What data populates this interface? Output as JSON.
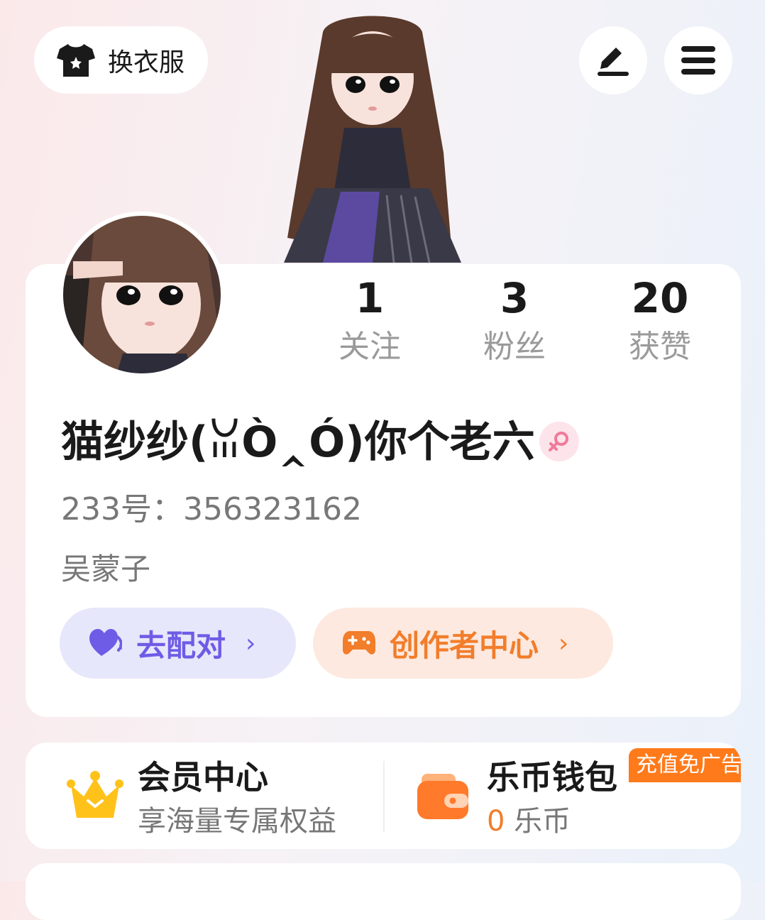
{
  "header": {
    "outfit_label": "换衣服",
    "icons": [
      "tshirt-icon",
      "pen-icon",
      "menu-icon"
    ]
  },
  "stats": [
    {
      "value": "1",
      "label": "关注"
    },
    {
      "value": "3",
      "label": "粉丝"
    },
    {
      "value": "20",
      "label": "获赞"
    }
  ],
  "profile": {
    "nickname": "猫纱纱(ꈍÒ‸Ó)你个老六",
    "gender_icon": "female-icon",
    "uid_label": "233号：",
    "uid_value": "356323162",
    "signature": "吴蒙子"
  },
  "actions": {
    "match_label": "去配对",
    "creator_label": "创作者中心",
    "chevron": "›"
  },
  "services": {
    "vip_title": "会员中心",
    "vip_sub": "享海量专属权益",
    "wallet_title": "乐币钱包",
    "wallet_amount": "0",
    "wallet_unit": " 乐币",
    "promo": "充值免广告"
  },
  "colors": {
    "accent_purple": "#6e5ce6",
    "accent_orange": "#f27d2b",
    "gender_pink": "#f07a9a"
  }
}
